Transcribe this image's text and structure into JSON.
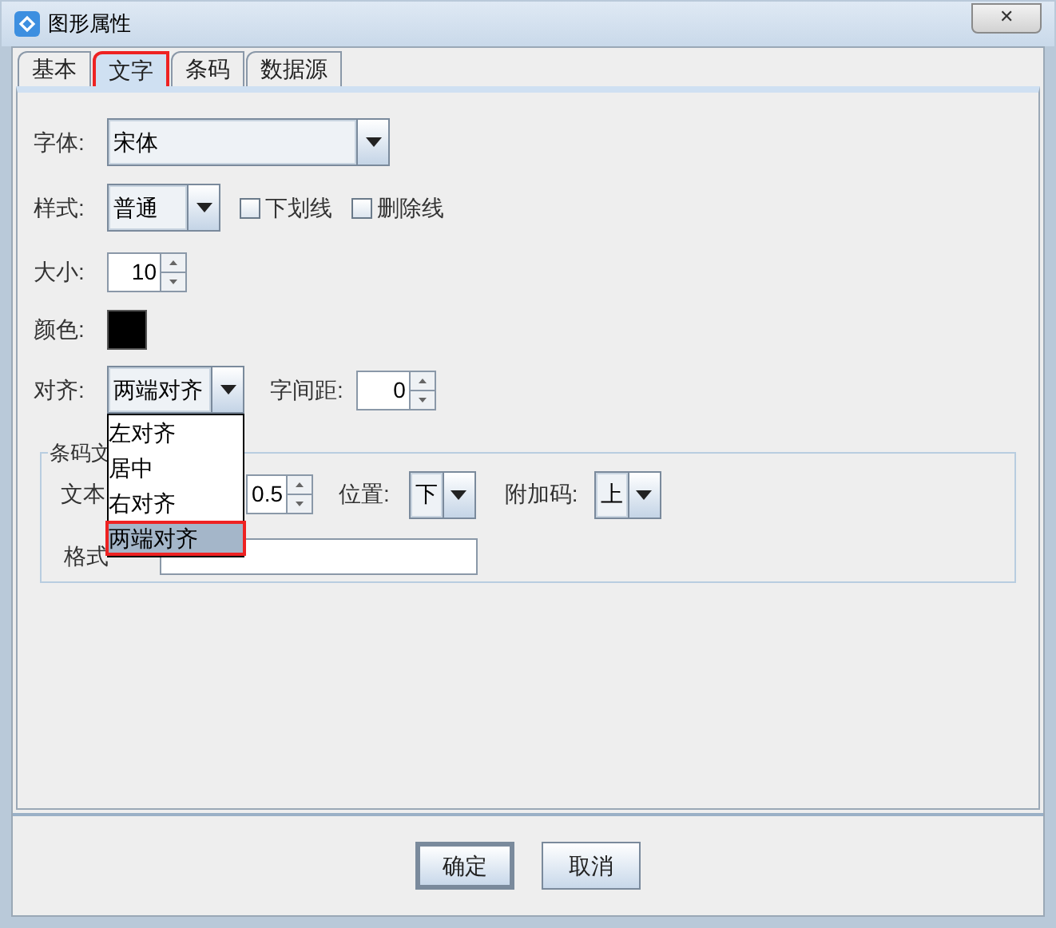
{
  "window": {
    "title": "图形属性",
    "close": "✕"
  },
  "tabs": [
    {
      "label": "基本",
      "selected": false,
      "highlighted": false
    },
    {
      "label": "文字",
      "selected": true,
      "highlighted": true
    },
    {
      "label": "条码",
      "selected": false,
      "highlighted": false
    },
    {
      "label": "数据源",
      "selected": false,
      "highlighted": false
    }
  ],
  "font": {
    "label": "字体:",
    "value": "宋体"
  },
  "style": {
    "label": "样式:",
    "value": "普通",
    "options": [
      {
        "label": "下划线",
        "checked": false
      },
      {
        "label": "删除线",
        "checked": false
      }
    ]
  },
  "size": {
    "label": "大小:",
    "value": "10"
  },
  "color": {
    "label": "颜色:",
    "color": "#000000"
  },
  "align": {
    "label": "对齐:",
    "value": "两端对齐",
    "expanded": true,
    "items": [
      {
        "label": "左对齐",
        "selected": false,
        "highlighted": false
      },
      {
        "label": "居中",
        "selected": false,
        "highlighted": false
      },
      {
        "label": "右对齐",
        "selected": false,
        "highlighted": false
      },
      {
        "label": "两端对齐",
        "selected": true,
        "highlighted": true
      }
    ]
  },
  "spacing": {
    "label": "字间距:",
    "value": "0"
  },
  "barcode_text_group": {
    "title": "条码文",
    "text_label": "文本",
    "text_value": "0.5",
    "position_label": "位置:",
    "position_value": "下",
    "addon_label": "附加码:",
    "addon_value": "上",
    "format_label": "格式"
  },
  "buttons": [
    {
      "label": "确定",
      "default": true
    },
    {
      "label": "取消",
      "default": false
    }
  ]
}
